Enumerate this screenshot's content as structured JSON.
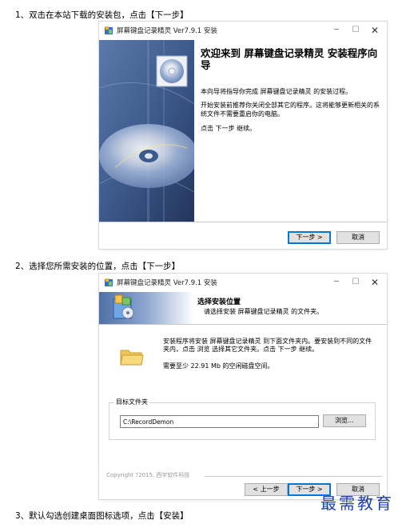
{
  "steps": [
    "1、双击在本站下载的安装包，点击【下一步】",
    "2、选择您所需安装的位置，点击【下一步】",
    "3、默认勾选创建桌面图标选项，点击【安装】"
  ],
  "dialog1": {
    "title": "屏幕键盘记录精灵 Ver7.9.1 安装",
    "heading": "欢迎来到 屏幕键盘记录精灵 安装程序向导",
    "para1": "本向导将指导你完成 屏幕键盘记录精灵 的安装过程。",
    "para2": "开始安装前推荐你关闭全部其它的程序。这将能够更新相关的系统文件不需要重启你的电脑。",
    "para3": "点击 下一步 继续。",
    "next_label": "下一步 >",
    "cancel_label": "取消"
  },
  "dialog2": {
    "title": "屏幕键盘记录精灵 Ver7.9.1 安装",
    "header_title": "选择安装位置",
    "header_sub": "请选择安装 屏幕键盘记录精灵 的文件夹。",
    "desc": "安装程序将安装 屏幕键盘记录精灵 到下面文件夹内。要安装到不同的文件夹内，点击 浏览 选择其它文件夹。点击 下一步 继续。",
    "space": "需要至少 22.91 Mb 的空闲磁盘空间。",
    "group_label": "目标文件夹",
    "path_value": "C:\\RecordDemon",
    "browse_label": "浏览...",
    "copyright": "Copyright ?2015, 西宇软件科技",
    "back_label": "< 上一步",
    "next_label": "下一步 >",
    "cancel_label": "取消"
  },
  "watermark": "最需教育",
  "colors": {
    "banner_blue": "#3d5a8c",
    "default_button_border": "#0078d7",
    "watermark": "#1e3ea8"
  }
}
